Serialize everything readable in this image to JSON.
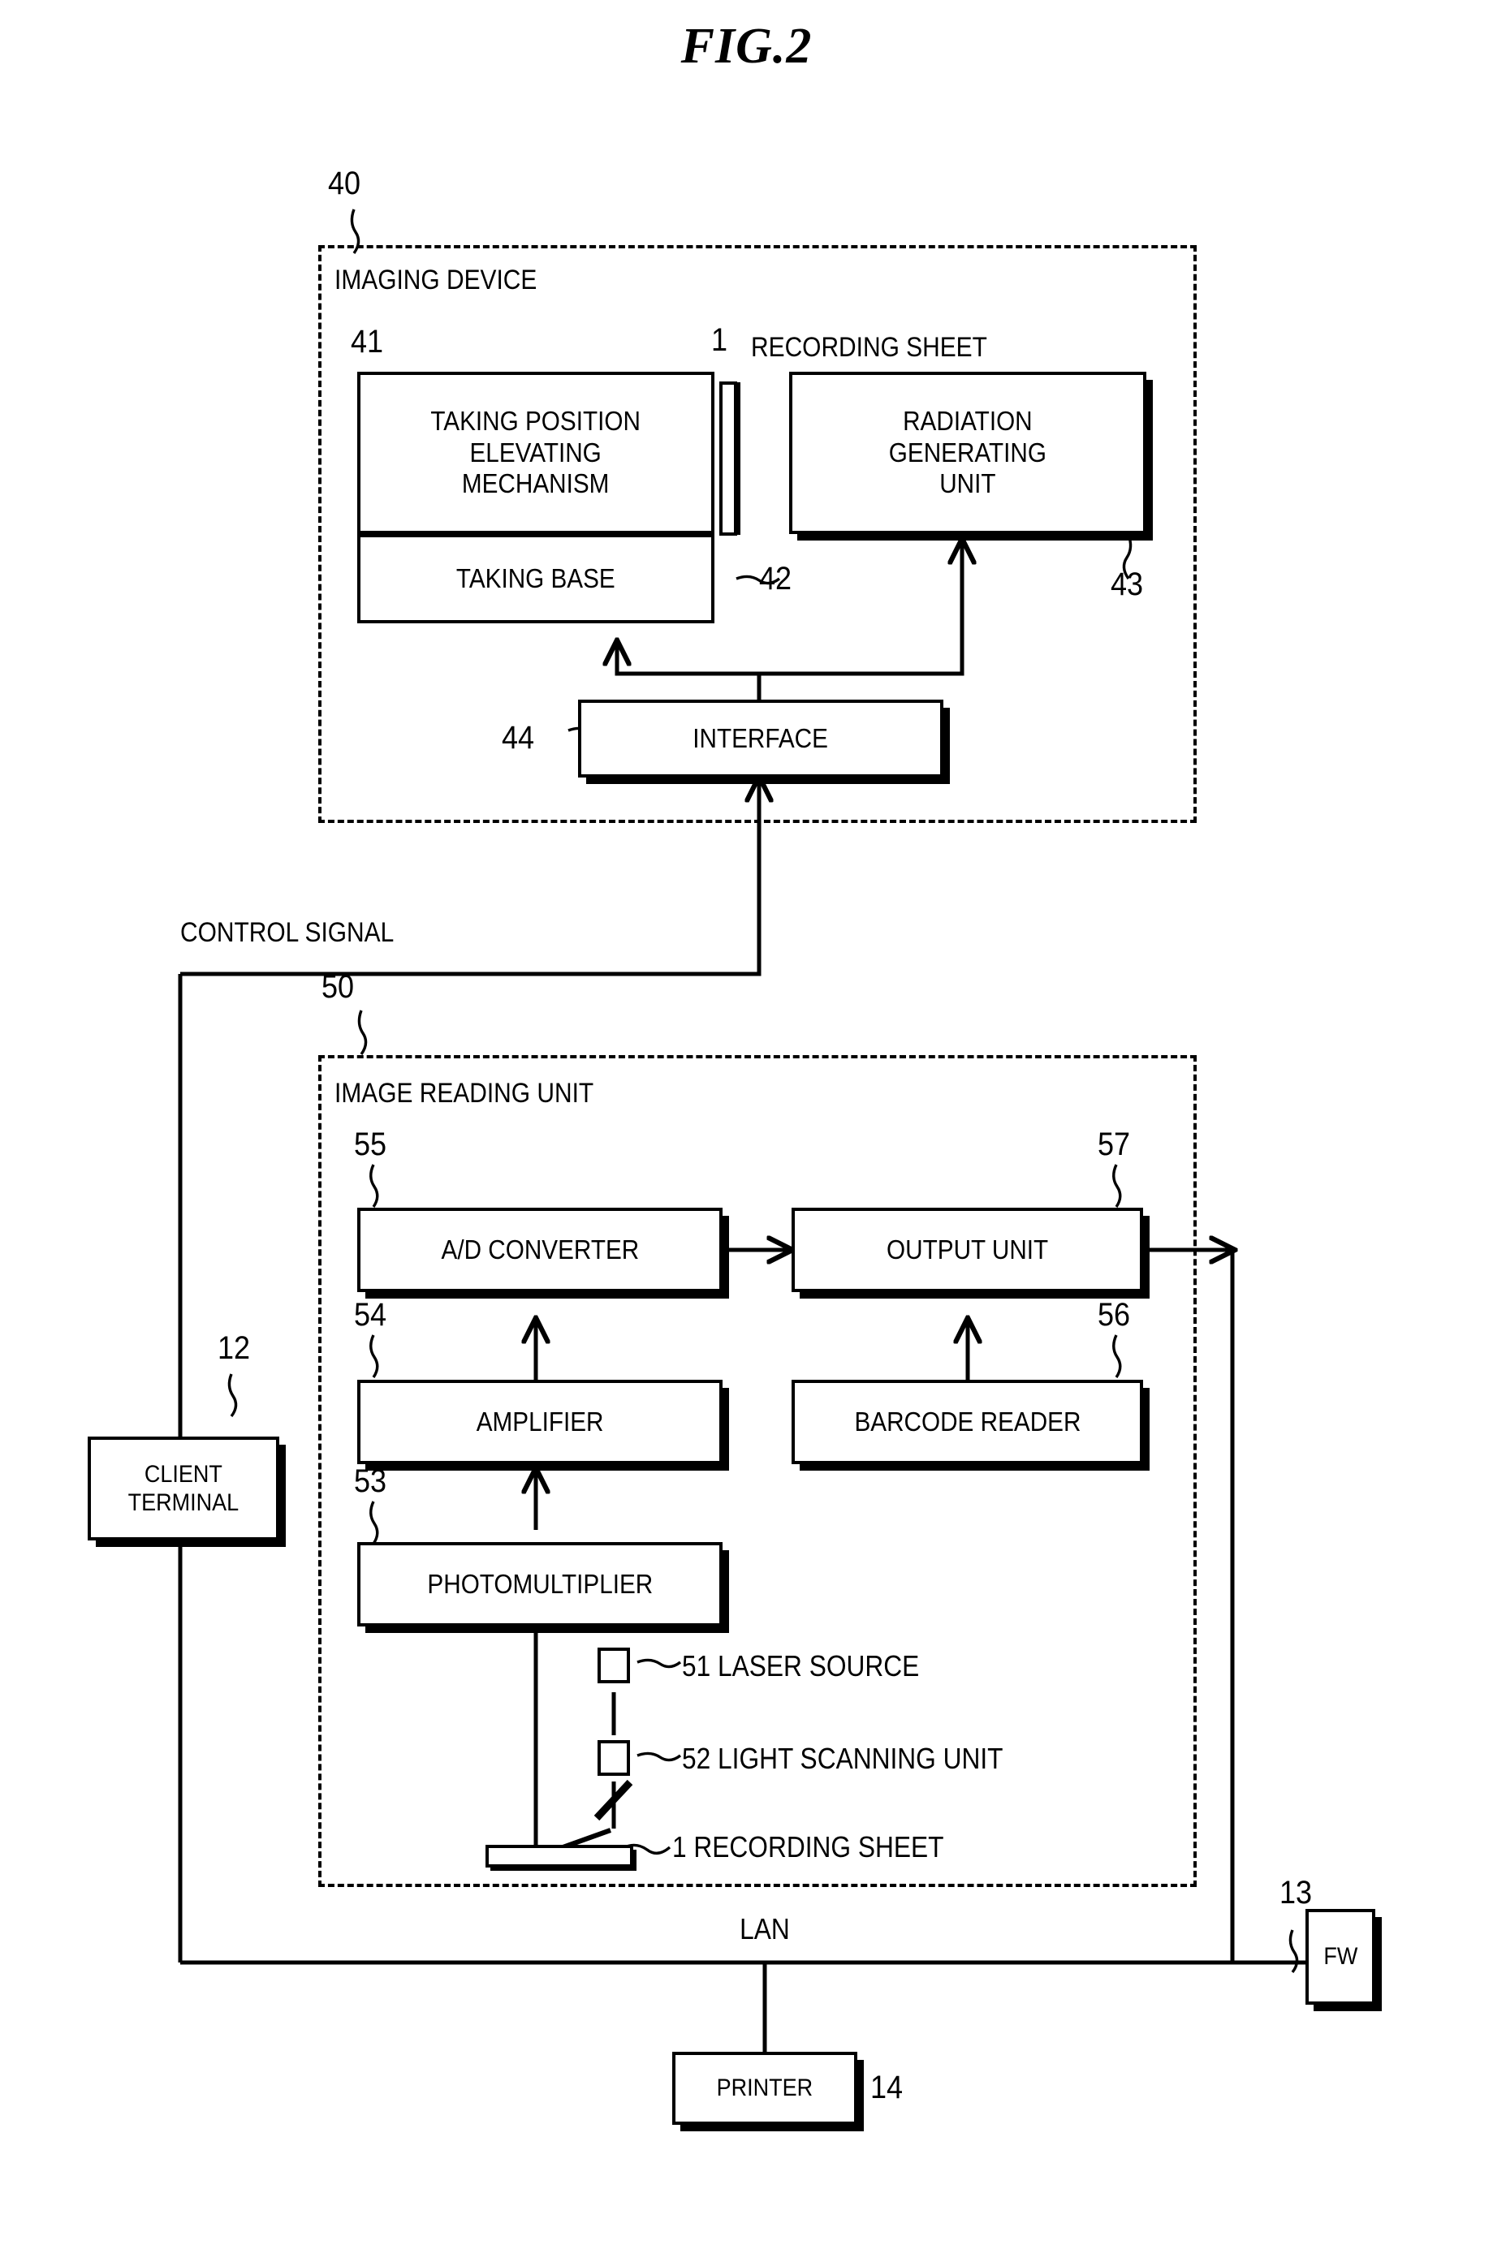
{
  "figure": {
    "title": "FIG.2"
  },
  "imaging_device": {
    "ref": "40",
    "title": "IMAGING DEVICE",
    "blocks": {
      "elevating": {
        "ref": "41",
        "label": "TAKING POSITION\nELEVATING\nMECHANISM"
      },
      "taking_base": {
        "ref": "42",
        "label": "TAKING BASE"
      },
      "radiation": {
        "ref": "43",
        "label": "RADIATION\nGENERATING\nUNIT"
      },
      "interface": {
        "ref": "44",
        "label": "INTERFACE"
      }
    },
    "recording_sheet": {
      "ref": "1",
      "label": "1 RECORDING SHEET"
    }
  },
  "control_signal": {
    "label": "CONTROL SIGNAL"
  },
  "client_terminal": {
    "ref": "12",
    "label": "CLIENT\nTERMINAL"
  },
  "image_reading_unit": {
    "ref": "50",
    "title": "IMAGE READING UNIT",
    "blocks": {
      "ad_converter": {
        "ref": "55",
        "label": "A/D CONVERTER"
      },
      "output_unit": {
        "ref": "57",
        "label": "OUTPUT UNIT"
      },
      "amplifier": {
        "ref": "54",
        "label": "AMPLIFIER"
      },
      "barcode_reader": {
        "ref": "56",
        "label": "BARCODE READER"
      },
      "photomultiplier": {
        "ref": "53",
        "label": "PHOTOMULTIPLIER"
      }
    },
    "optics": {
      "laser_source": {
        "ref": "51",
        "label": "51 LASER SOURCE"
      },
      "light_scanning_unit": {
        "ref": "52",
        "label": "52 LIGHT SCANNING UNIT"
      },
      "recording_sheet": {
        "ref": "1",
        "label": "1 RECORDING SHEET"
      }
    }
  },
  "network": {
    "lan_label": "LAN",
    "firewall": {
      "ref": "13",
      "label": "FW"
    },
    "printer": {
      "ref": "14",
      "label": "PRINTER"
    }
  },
  "colors": {
    "ink": "#000000",
    "paper": "#ffffff"
  }
}
